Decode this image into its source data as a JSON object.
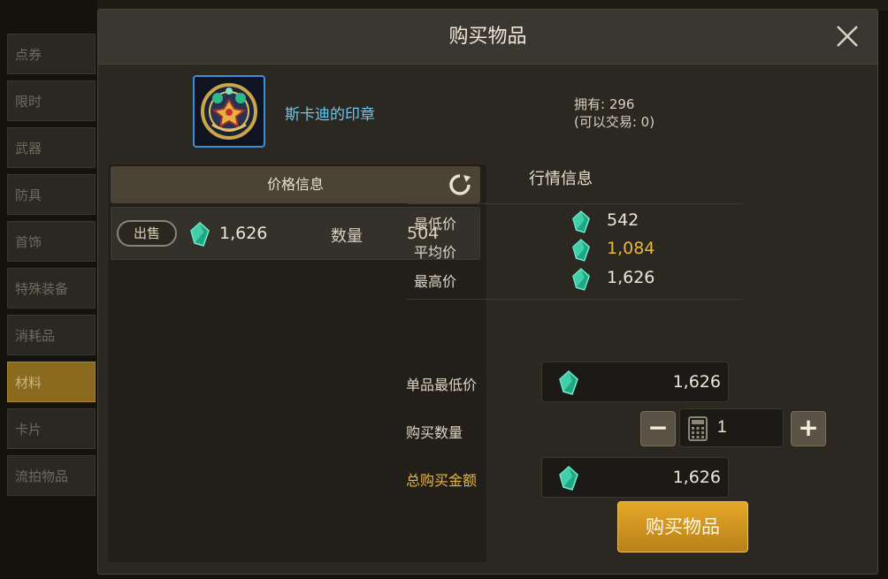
{
  "sidebar": {
    "items": [
      "点券",
      "限时",
      "武器",
      "防具",
      "首饰",
      "特殊装备",
      "消耗品",
      "材料",
      "卡片",
      "流拍物品"
    ],
    "active_index": 7
  },
  "dialog": {
    "title": "购买物品",
    "close_icon": "close-icon"
  },
  "item": {
    "name": "斯卡迪的印章",
    "owned_line": "拥有: 296",
    "tradeable_line": "(可以交易: 0)",
    "icon": "seal-medallion-icon"
  },
  "price_info": {
    "header": "价格信息",
    "refresh_icon": "refresh-icon",
    "listing": {
      "tag": "出售",
      "price": "1,626",
      "qty_label": "数量",
      "qty": "504"
    }
  },
  "market": {
    "title": "行情信息",
    "rows": [
      {
        "label": "最低价",
        "value": "542"
      },
      {
        "label": "平均价",
        "value": "1,084"
      },
      {
        "label": "最高价",
        "value": "1,626"
      }
    ]
  },
  "purchase": {
    "unit_min_label": "单品最低价",
    "unit_min_value": "1,626",
    "qty_label": "购买数量",
    "qty_value": "1",
    "minus": "−",
    "plus": "+",
    "total_label": "总购买金额",
    "total_value": "1,626",
    "buy_button": "购买物品"
  },
  "colors": {
    "accent_gold": "#e8b63e",
    "item_name_blue": "#6ac8f2",
    "gem_green": "#2fd1a8"
  }
}
